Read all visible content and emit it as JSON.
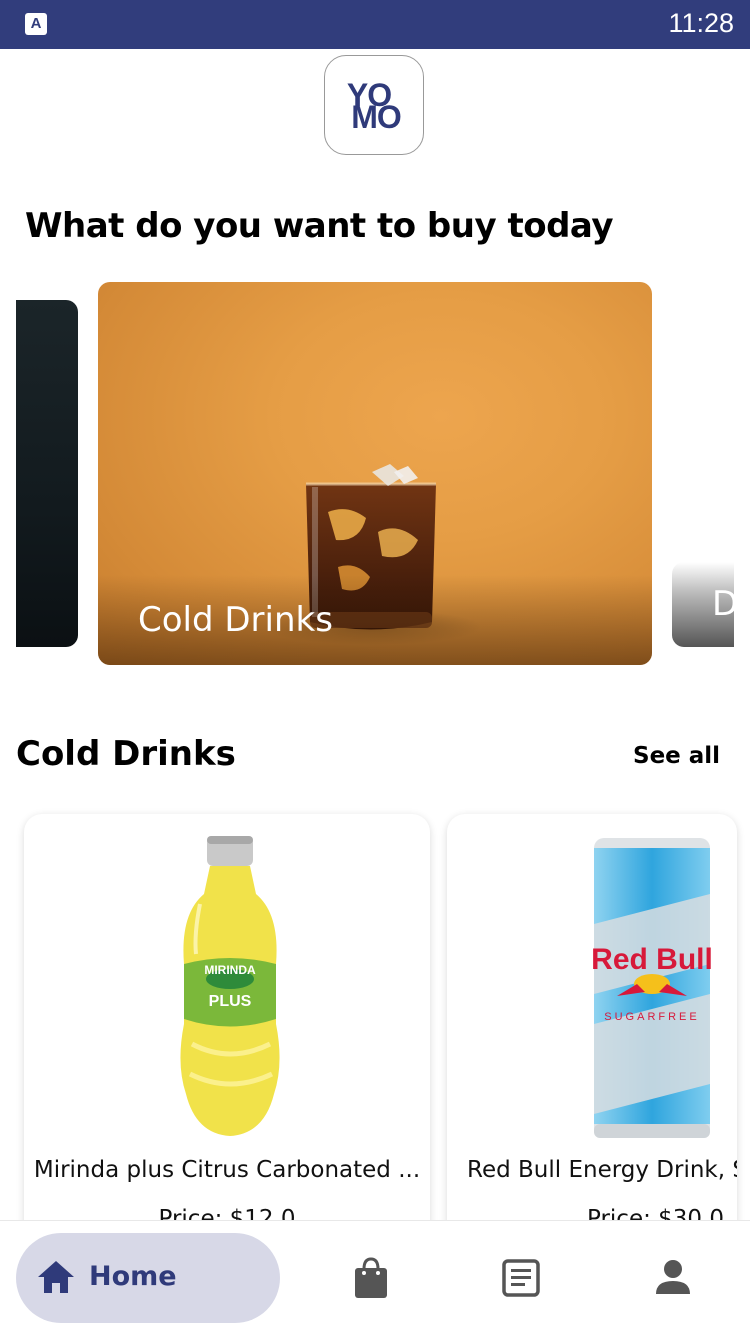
{
  "status_bar": {
    "app_icon_letter": "A",
    "time": "11:28"
  },
  "logo": {
    "line1": "YO",
    "line2": "MO"
  },
  "heading": "What do you want to buy today",
  "carousel": {
    "cards": [
      {
        "label": ""
      },
      {
        "label": "Cold Drinks"
      },
      {
        "label": "D"
      }
    ]
  },
  "section": {
    "title": "Cold Drinks",
    "see_all": "See all"
  },
  "products": [
    {
      "name": "Mirinda plus Citrus Carbonated ...",
      "price": "Price: $12.0"
    },
    {
      "name": "Red Bull Energy Drink, Su",
      "price": "Price: $30.0"
    }
  ],
  "bottom_nav": {
    "items": [
      {
        "label": "Home",
        "icon": "home-icon",
        "active": true
      },
      {
        "label": "",
        "icon": "shopping-bag-icon",
        "active": false
      },
      {
        "label": "",
        "icon": "orders-icon",
        "active": false
      },
      {
        "label": "",
        "icon": "profile-icon",
        "active": false
      }
    ]
  },
  "colors": {
    "brand": "#313d7c",
    "nav_active_bg": "#d7d8e7",
    "icon_gray": "#555555"
  }
}
